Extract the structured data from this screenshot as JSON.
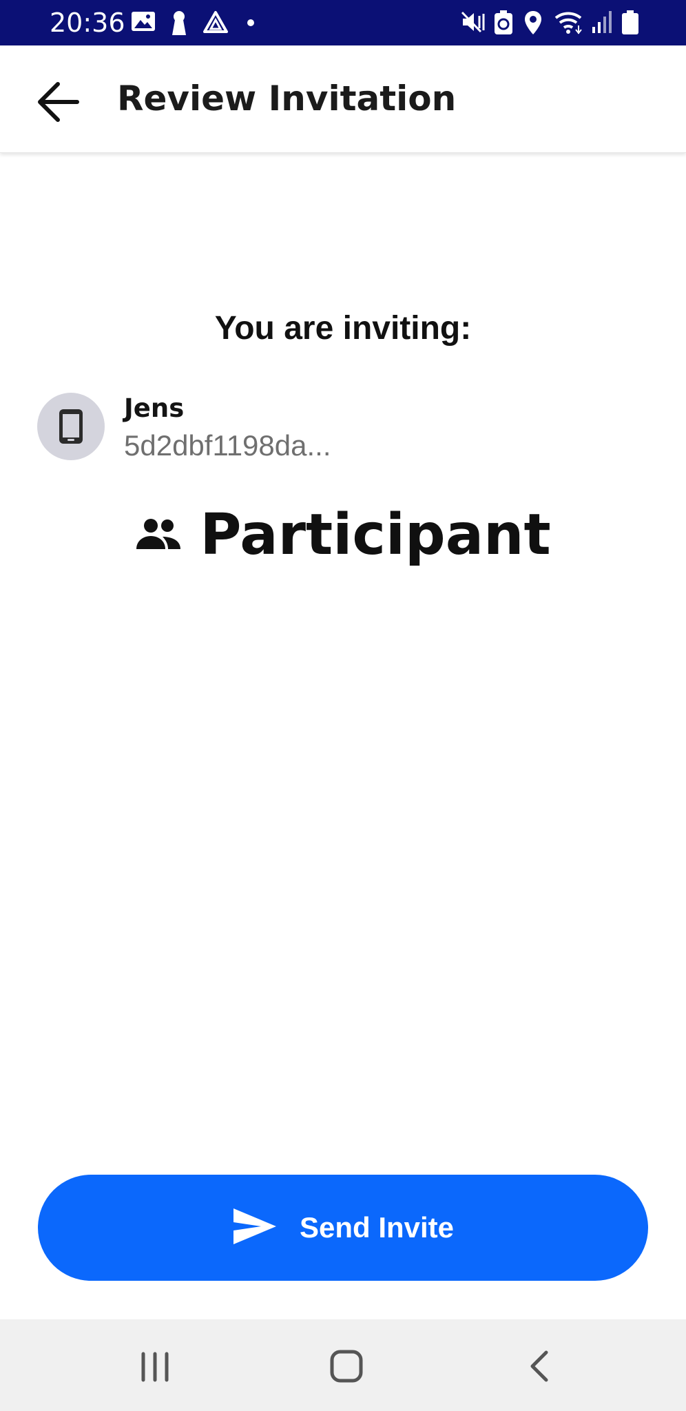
{
  "status_bar": {
    "time": "20:36",
    "background": "#0b1075",
    "left_icons": [
      "gallery-icon",
      "keyhole-icon",
      "warning-triangle-icon",
      "notification-dot-icon"
    ],
    "right_icons": [
      "mute-vibrate-icon",
      "battery-saver-icon",
      "location-icon",
      "wifi-icon",
      "signal-icon",
      "battery-icon"
    ]
  },
  "app_bar": {
    "back_icon": "arrow-left-icon",
    "title": "Review Invitation"
  },
  "main": {
    "heading": "You are inviting:",
    "invitee": {
      "avatar_icon": "smartphone-icon",
      "name": "Jens",
      "id": "5d2dbf1198da..."
    },
    "role": {
      "icon": "people-icon",
      "label": "Participant"
    }
  },
  "send_button": {
    "icon": "send-icon",
    "label": "Send Invite",
    "color": "#0b68fc"
  },
  "nav_bar": {
    "buttons": [
      "recents-icon",
      "home-icon",
      "back-icon"
    ]
  }
}
